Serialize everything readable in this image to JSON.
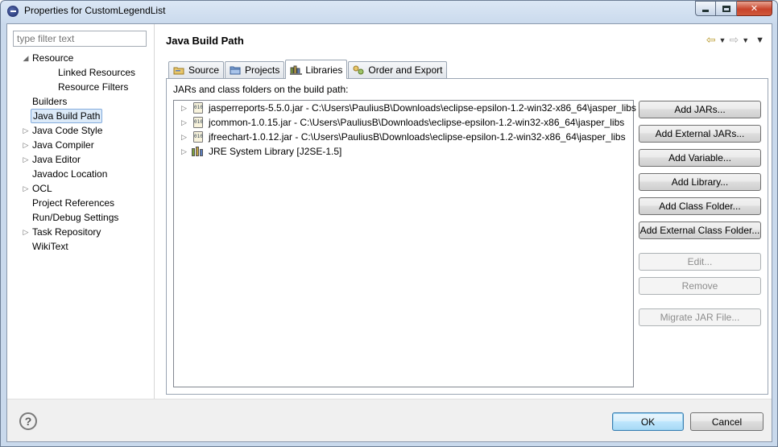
{
  "window": {
    "title": "Properties for CustomLegendList"
  },
  "filter": {
    "placeholder": "type filter text"
  },
  "tree": [
    {
      "label": "Resource",
      "expanded": true,
      "level": 0,
      "arrow": "◢"
    },
    {
      "label": "Linked Resources",
      "level": 1
    },
    {
      "label": "Resource Filters",
      "level": 1
    },
    {
      "label": "Builders",
      "level": 0
    },
    {
      "label": "Java Build Path",
      "level": 0,
      "selected": true
    },
    {
      "label": "Java Code Style",
      "level": 0,
      "arrow": "▷"
    },
    {
      "label": "Java Compiler",
      "level": 0,
      "arrow": "▷"
    },
    {
      "label": "Java Editor",
      "level": 0,
      "arrow": "▷"
    },
    {
      "label": "Javadoc Location",
      "level": 0
    },
    {
      "label": "OCL",
      "level": 0,
      "arrow": "▷"
    },
    {
      "label": "Project References",
      "level": 0
    },
    {
      "label": "Run/Debug Settings",
      "level": 0
    },
    {
      "label": "Task Repository",
      "level": 0,
      "arrow": "▷"
    },
    {
      "label": "WikiText",
      "level": 0
    }
  ],
  "page": {
    "title": "Java Build Path"
  },
  "icons": {
    "back": "back-arrow-icon",
    "forward": "forward-arrow-icon",
    "menu": "view-menu-icon"
  },
  "tabs": [
    {
      "label": "Source",
      "icon": "source-folder-icon"
    },
    {
      "label": "Projects",
      "icon": "projects-folder-icon"
    },
    {
      "label": "Libraries",
      "icon": "libraries-icon",
      "active": true
    },
    {
      "label": "Order and Export",
      "icon": "order-export-icon"
    }
  ],
  "panel": {
    "label": "JARs and class folders on the build path:"
  },
  "entries": [
    {
      "text": "jasperreports-5.5.0.jar - C:\\Users\\PauliusB\\Downloads\\eclipse-epsilon-1.2-win32-x86_64\\jasper_libs",
      "icon": "jar-icon"
    },
    {
      "text": "jcommon-1.0.15.jar - C:\\Users\\PauliusB\\Downloads\\eclipse-epsilon-1.2-win32-x86_64\\jasper_libs",
      "icon": "jar-icon"
    },
    {
      "text": "jfreechart-1.0.12.jar - C:\\Users\\PauliusB\\Downloads\\eclipse-epsilon-1.2-win32-x86_64\\jasper_libs",
      "icon": "jar-icon"
    },
    {
      "text": "JRE System Library [J2SE-1.5]",
      "icon": "library-icon"
    }
  ],
  "buttons": [
    {
      "label": "Add JARs...",
      "enabled": true
    },
    {
      "label": "Add External JARs...",
      "enabled": true
    },
    {
      "label": "Add Variable...",
      "enabled": true
    },
    {
      "label": "Add Library...",
      "enabled": true
    },
    {
      "label": "Add Class Folder...",
      "enabled": true
    },
    {
      "label": "Add External Class Folder...",
      "enabled": true
    },
    {
      "label": "Edit...",
      "enabled": false
    },
    {
      "label": "Remove",
      "enabled": false
    },
    {
      "label": "Migrate JAR File...",
      "enabled": false
    }
  ],
  "footer": {
    "help": "?",
    "ok": "OK",
    "cancel": "Cancel"
  }
}
